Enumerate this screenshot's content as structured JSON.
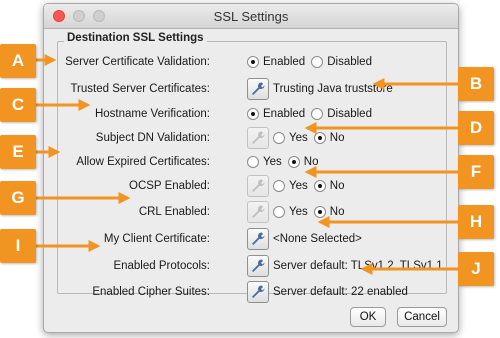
{
  "window": {
    "title": "SSL Settings"
  },
  "group": {
    "title": "Destination SSL Settings"
  },
  "rows": {
    "server_cert_validation": {
      "label": "Server Certificate Validation:",
      "opt1": "Enabled",
      "opt2": "Disabled",
      "selected": "Enabled"
    },
    "trusted_certs": {
      "label": "Trusted Server Certificates:",
      "value": "Trusting Java truststore"
    },
    "hostname_verification": {
      "label": "Hostname Verification:",
      "opt1": "Enabled",
      "opt2": "Disabled",
      "selected": "Enabled"
    },
    "subject_dn": {
      "label": "Subject DN Validation:",
      "opt1": "Yes",
      "opt2": "No",
      "selected": "No"
    },
    "allow_expired": {
      "label": "Allow Expired Certificates:",
      "opt1": "Yes",
      "opt2": "No",
      "selected": "No"
    },
    "ocsp": {
      "label": "OCSP Enabled:",
      "opt1": "Yes",
      "opt2": "No",
      "selected": "No"
    },
    "crl": {
      "label": "CRL Enabled:",
      "opt1": "Yes",
      "opt2": "No",
      "selected": "No"
    },
    "client_cert": {
      "label": "My Client Certificate:",
      "value": "<None Selected>"
    },
    "protocols": {
      "label": "Enabled Protocols:",
      "value": "Server default: TLSv1.2, TLSv1.1"
    },
    "cipher_suites": {
      "label": "Enabled Cipher Suites:",
      "value": "Server default: 22 enabled"
    }
  },
  "buttons": {
    "ok": "OK",
    "cancel": "Cancel"
  },
  "callouts": {
    "A": "A",
    "B": "B",
    "C": "C",
    "D": "D",
    "E": "E",
    "F": "F",
    "G": "G",
    "H": "H",
    "I": "I",
    "J": "J"
  },
  "colors": {
    "callout": "#f29421",
    "close": "#fc5753"
  }
}
